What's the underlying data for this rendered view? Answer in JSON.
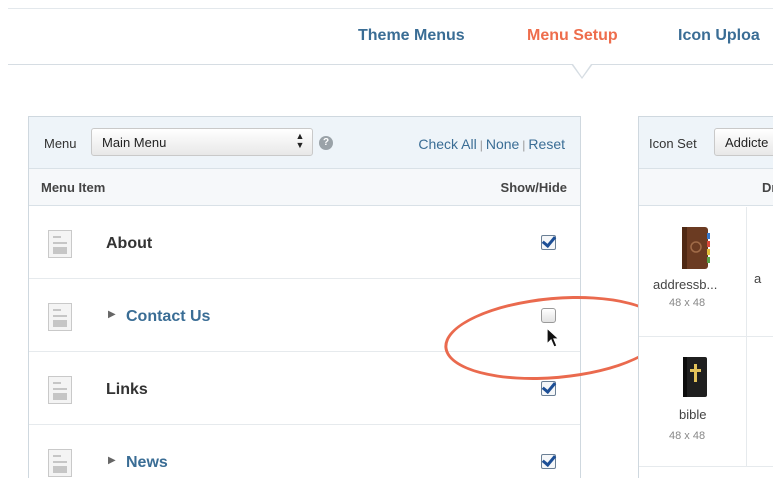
{
  "nav": {
    "tabs": [
      {
        "label": "Theme Menus"
      },
      {
        "label": "Menu Setup",
        "active": true
      },
      {
        "label": "Icon Uploa"
      }
    ],
    "accent": "#ee6d4c",
    "link_color": "#3a6d95"
  },
  "menu_panel": {
    "menu_label": "Menu",
    "menu_select": "Main Menu",
    "help": "?",
    "actions": {
      "check_all": "Check All",
      "none": "None",
      "reset": "Reset",
      "separator": "|"
    },
    "columns": {
      "item": "Menu Item",
      "show_hide": "Show/Hide"
    },
    "rows": [
      {
        "label": "About",
        "expandable": false,
        "checked": true
      },
      {
        "label": "Contact Us",
        "expandable": true,
        "checked": false
      },
      {
        "label": "Links",
        "expandable": false,
        "checked": true
      },
      {
        "label": "News",
        "expandable": true,
        "checked": true
      }
    ]
  },
  "icon_panel": {
    "iconset_label": "Icon Set",
    "iconset_select": "Addicte",
    "column": "Drag",
    "icons": [
      {
        "name": "addressb...",
        "size": "48 x 48",
        "icon": "address-book-icon"
      },
      {
        "name": "bible",
        "size": "48 x 48",
        "icon": "bible-icon"
      }
    ],
    "partial_name": "a"
  }
}
